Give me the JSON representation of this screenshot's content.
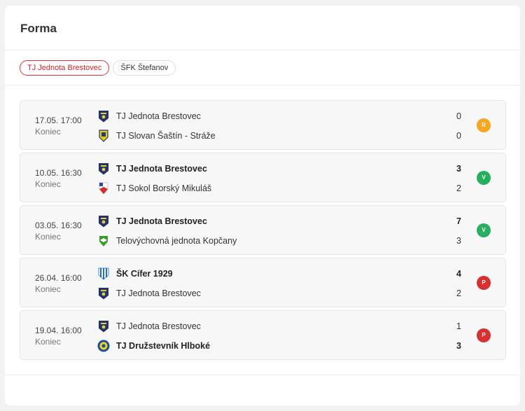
{
  "widget": {
    "title": "Forma"
  },
  "tabs": [
    {
      "label": "TJ Jednota Brestovec",
      "active": true
    },
    {
      "label": "ŠFK Štefanov",
      "active": false
    }
  ],
  "colors": {
    "accent": "#d6373e",
    "draw": "#f5a623",
    "win": "#27ae60",
    "loss": "#d63031"
  },
  "matches": [
    {
      "date": "17.05. 17:00",
      "status": "Koniec",
      "home": {
        "name": "TJ Jednota Brestovec",
        "score": "0",
        "crest": "crest-brestovec-icon"
      },
      "away": {
        "name": "TJ Slovan Šaštín - Stráže",
        "score": "0",
        "crest": "crest-sastin-icon"
      },
      "result": "R"
    },
    {
      "date": "10.05. 16:30",
      "status": "Koniec",
      "home": {
        "name": "TJ Jednota Brestovec",
        "score": "3",
        "crest": "crest-brestovec-icon"
      },
      "away": {
        "name": "TJ Sokol Borský Mikuláš",
        "score": "2",
        "crest": "crest-borsky-icon"
      },
      "result": "V"
    },
    {
      "date": "03.05. 16:30",
      "status": "Koniec",
      "home": {
        "name": "TJ Jednota Brestovec",
        "score": "7",
        "crest": "crest-brestovec-icon"
      },
      "away": {
        "name": "Telovýchovná jednota Kopčany",
        "score": "3",
        "crest": "crest-kopcany-icon"
      },
      "result": "V"
    },
    {
      "date": "26.04. 16:00",
      "status": "Koniec",
      "home": {
        "name": "ŠK Cífer 1929",
        "score": "4",
        "crest": "crest-cifer-icon"
      },
      "away": {
        "name": "TJ Jednota Brestovec",
        "score": "2",
        "crest": "crest-brestovec-icon"
      },
      "result": "P"
    },
    {
      "date": "19.04. 16:00",
      "status": "Koniec",
      "home": {
        "name": "TJ Jednota Brestovec",
        "score": "1",
        "crest": "crest-brestovec-icon"
      },
      "away": {
        "name": "TJ Družstevník Hlboké",
        "score": "3",
        "crest": "crest-hlboke-icon"
      },
      "result": "P"
    }
  ]
}
